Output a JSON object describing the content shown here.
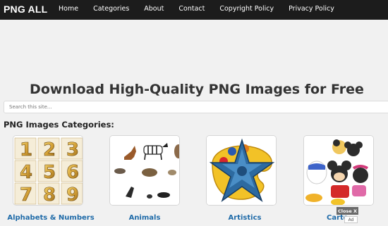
{
  "header": {
    "logo": "PNG ALL",
    "nav": [
      "Home",
      "Categories",
      "About",
      "Contact",
      "Copyright Policy",
      "Privacy Policy"
    ]
  },
  "hero": {
    "title": "Download High-Quality PNG Images for Free"
  },
  "search": {
    "placeholder": "Search this site..."
  },
  "categories": {
    "heading": "PNG Images Categories:",
    "items": [
      {
        "label": "Alphabets & Numbers",
        "icon": "numbers-thumbnail"
      },
      {
        "label": "Animals",
        "icon": "animals-thumbnail"
      },
      {
        "label": "Artistics",
        "icon": "star-palette-thumbnail"
      },
      {
        "label": "Carto",
        "icon": "cartoon-thumbnail"
      }
    ]
  },
  "ad": {
    "close_label": "Close X",
    "badge": "Ad"
  },
  "colors": {
    "topbar": "#1c1c1c",
    "page_bg": "#f1f1f1",
    "link": "#1e6aa8",
    "gold": "#c99a2e"
  }
}
